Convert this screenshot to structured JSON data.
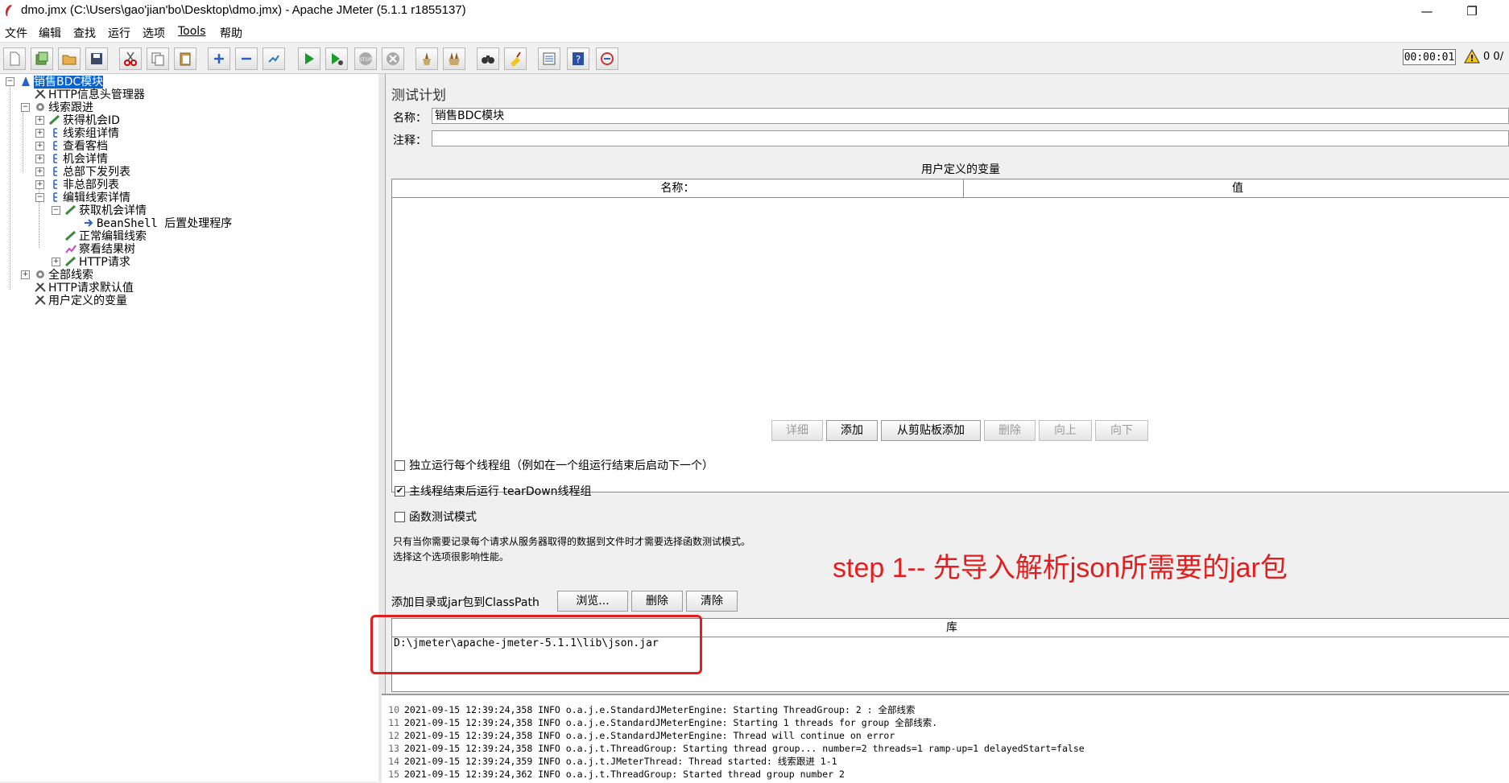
{
  "window": {
    "title": "dmo.jmx (C:\\Users\\gao'jian'bo\\Desktop\\dmo.jmx) - Apache JMeter (5.1.1 r1855137)",
    "minimize_glyph": "—",
    "maximize_glyph": "❐"
  },
  "menu": [
    "文件",
    "编辑",
    "查找",
    "运行",
    "选项",
    "Tools",
    "帮助"
  ],
  "toolbar": {
    "icons": [
      "new-icon",
      "templates-icon",
      "open-icon",
      "save-icon",
      "cut-icon",
      "copy-icon",
      "paste-icon",
      "expand-icon",
      "collapse-icon",
      "toggle-icon",
      "start-icon",
      "start-no-pause-icon",
      "stop-icon",
      "shutdown-icon",
      "clear-icon",
      "clear-all-icon",
      "search-icon",
      "reset-search-icon",
      "function-helper-icon",
      "help-icon",
      "remote-icon"
    ],
    "timer": "00:00:01",
    "warning_count": "0",
    "extra": "0/"
  },
  "tree": {
    "nodes": [
      {
        "label": "销售BDC模块",
        "icon": "test-plan-icon",
        "selected": true
      },
      {
        "label": "HTTP信息头管理器",
        "icon": "config-wrench-icon"
      },
      {
        "label": "线索跟进",
        "icon": "thread-group-gear-icon"
      },
      {
        "label": "获得机会ID",
        "icon": "sampler-pen-icon"
      },
      {
        "label": "线索组详情",
        "icon": "sampler-icon"
      },
      {
        "label": "查看客档",
        "icon": "sampler-icon"
      },
      {
        "label": "机会详情",
        "icon": "sampler-icon"
      },
      {
        "label": "总部下发列表",
        "icon": "sampler-icon"
      },
      {
        "label": "非总部列表",
        "icon": "sampler-icon"
      },
      {
        "label": "编辑线索详情",
        "icon": "sampler-icon"
      },
      {
        "label": "获取机会详情",
        "icon": "sampler-pen-icon"
      },
      {
        "label": "BeanShell 后置处理程序",
        "icon": "post-processor-arrow-icon"
      },
      {
        "label": "正常编辑线索",
        "icon": "sampler-pen-icon"
      },
      {
        "label": "察看结果树",
        "icon": "listener-chart-icon"
      },
      {
        "label": "HTTP请求",
        "icon": "sampler-pen-icon"
      },
      {
        "label": "全部线索",
        "icon": "thread-group-gear-icon"
      },
      {
        "label": "HTTP请求默认值",
        "icon": "config-wrench-icon"
      },
      {
        "label": "用户定义的变量",
        "icon": "config-wrench-icon"
      }
    ]
  },
  "panel": {
    "heading": "测试计划",
    "name_label": "名称：",
    "name_value": "销售BDC模块",
    "comment_label": "注释：",
    "comment_value": "",
    "vars_title": "用户定义的变量",
    "vars_columns": [
      "名称：",
      "值"
    ],
    "vars_buttons": [
      {
        "label": "详细",
        "enabled": false
      },
      {
        "label": "添加",
        "enabled": true
      },
      {
        "label": "从剪贴板添加",
        "enabled": true
      },
      {
        "label": "删除",
        "enabled": false
      },
      {
        "label": "向上",
        "enabled": false
      },
      {
        "label": "向下",
        "enabled": false
      }
    ],
    "options": [
      {
        "label": "独立运行每个线程组（例如在一个组运行结束后启动下一个）",
        "checked": false
      },
      {
        "label": "主线程结束后运行 tearDown线程组",
        "checked": true
      },
      {
        "label": "函数测试模式",
        "checked": false
      }
    ],
    "hint_line1": "只有当你需要记录每个请求从服务器取得的数据到文件时才需要选择函数测试模式。",
    "hint_line2": "选择这个选项很影响性能。",
    "classpath_label": "添加目录或jar包到ClassPath",
    "browse_button": "浏览...",
    "delete_button": "删除",
    "clear_button": "清除",
    "lib_column": "库",
    "lib_rows": [
      "D:\\jmeter\\apache-jmeter-5.1.1\\lib\\json.jar"
    ]
  },
  "annotation": {
    "text": "step  1-- 先导入解析json所需要的jar包",
    "color": "#e31e1e"
  },
  "log": {
    "lines": [
      {
        "no": "10",
        "text": "2021-09-15 12:39:24,358 INFO o.a.j.e.StandardJMeterEngine: Starting ThreadGroup: 2 : 全部线索"
      },
      {
        "no": "11",
        "text": "2021-09-15 12:39:24,358 INFO o.a.j.e.StandardJMeterEngine: Starting 1 threads for group 全部线索."
      },
      {
        "no": "12",
        "text": "2021-09-15 12:39:24,358 INFO o.a.j.e.StandardJMeterEngine: Thread will continue on error"
      },
      {
        "no": "13",
        "text": "2021-09-15 12:39:24,358 INFO o.a.j.t.ThreadGroup: Starting thread group... number=2 threads=1 ramp-up=1 delayedStart=false"
      },
      {
        "no": "14",
        "text": "2021-09-15 12:39:24,359 INFO o.a.j.t.JMeterThread: Thread started: 线索跟进 1-1"
      },
      {
        "no": "15",
        "text": "2021-09-15 12:39:24,362 INFO o.a.j.t.ThreadGroup: Started thread group number 2"
      }
    ]
  }
}
